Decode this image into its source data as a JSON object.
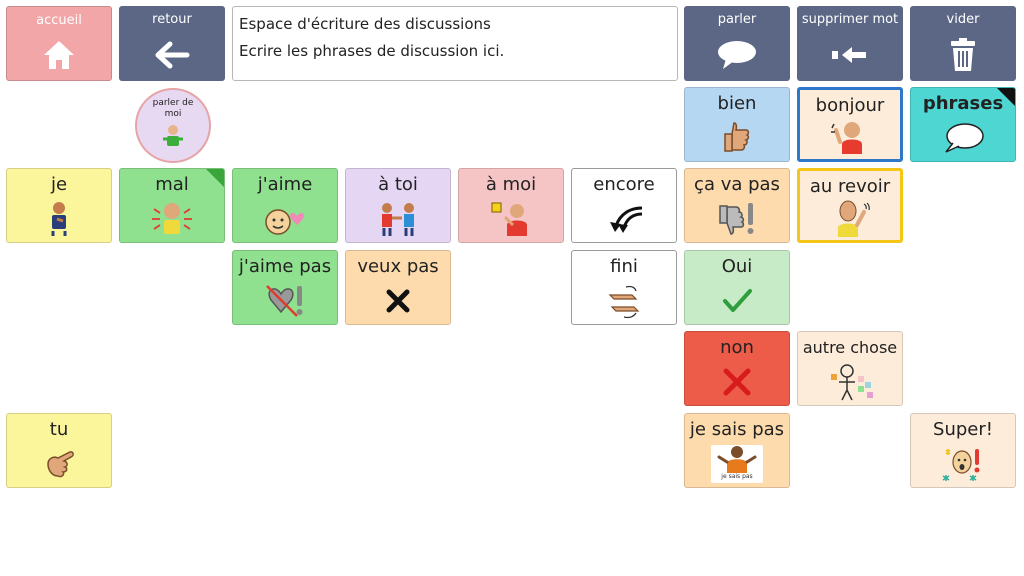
{
  "nav": {
    "home": "accueil",
    "back": "retour",
    "speak": "parler",
    "delete_word": "supprimer mot",
    "clear": "vider"
  },
  "message": {
    "line1": "Espace d'écriture des discussions",
    "line2": "Ecrire les phrases de discussion ici."
  },
  "folder": {
    "label": "parler de moi"
  },
  "tiles": {
    "je": "je",
    "mal": "mal",
    "jaime": "j'aime",
    "a_toi": "à toi",
    "a_moi": "à moi",
    "encore": "encore",
    "ca_va_pas": "ça va pas",
    "au_revoir": "au revoir",
    "bien": "bien",
    "bonjour": "bonjour",
    "phrases": "phrases",
    "jaime_pas": "j'aime pas",
    "veux_pas": "veux pas",
    "fini": "fini",
    "oui": "Oui",
    "non": "non",
    "autre_chose": "autre chose",
    "tu": "tu",
    "je_sais_pas": "je sais pas",
    "je_sais_pas_caption": "je sais pas",
    "super": "Super!"
  },
  "colors": {
    "nav": "#5b6785",
    "home": "#f2a6a8",
    "pronoun": "#fbf59b",
    "feeling": "#8fe08f",
    "negative": "#ec5c48",
    "highlight_blue": "#2e77c9",
    "highlight_yellow": "#f5c518"
  },
  "icons": {
    "home": "house-icon",
    "back": "arrow-left-icon",
    "speak": "speech-bubble-icon",
    "delete": "backspace-icon",
    "clear": "trash-icon"
  }
}
